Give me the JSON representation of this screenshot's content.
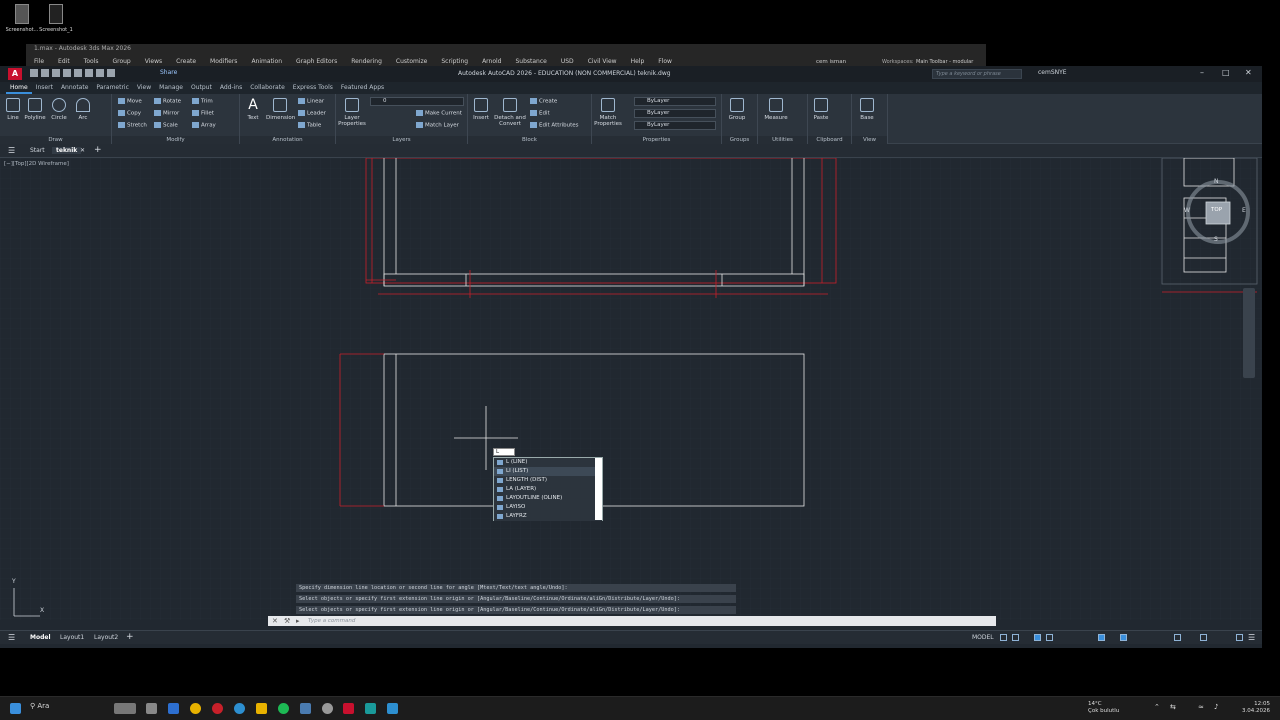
{
  "desktop": {
    "icons": [
      {
        "label": "Screenshot..."
      },
      {
        "label": "Screenshot_1"
      }
    ]
  },
  "max": {
    "title": "1.max - Autodesk 3ds Max 2026",
    "menu": [
      "File",
      "Edit",
      "Tools",
      "Group",
      "Views",
      "Create",
      "Modifiers",
      "Animation",
      "Graph Editors",
      "Rendering",
      "Customize",
      "Scripting",
      "Arnold",
      "Substance",
      "USD",
      "Civil View",
      "Help",
      "Flow"
    ],
    "user": "cem isman",
    "workspace_label": "Workspaces:",
    "workspace": "Main Toolbar - modular"
  },
  "acad": {
    "title": "Autodesk AutoCAD 2026 - EDUCATION (NON COMMERCIAL)   teknik.dwg",
    "share": "Share",
    "search_placeholder": "Type a keyword or phrase",
    "user": "cemSNYE",
    "app_letter": "A",
    "tabs": [
      "Home",
      "Insert",
      "Annotate",
      "Parametric",
      "View",
      "Manage",
      "Output",
      "Add-ins",
      "Collaborate",
      "Express Tools",
      "Featured Apps"
    ],
    "ribbon": {
      "draw": {
        "title": "Draw",
        "line": "Line",
        "polyline": "Polyline",
        "circle": "Circle",
        "arc": "Arc"
      },
      "modify": {
        "title": "Modify",
        "move": "Move",
        "rotate": "Rotate",
        "trim": "Trim",
        "copy": "Copy",
        "mirror": "Mirror",
        "fillet": "Fillet",
        "stretch": "Stretch",
        "scale": "Scale",
        "array": "Array"
      },
      "annotation": {
        "title": "Annotation",
        "text": "Text",
        "dimension": "Dimension",
        "linear": "Linear",
        "leader": "Leader",
        "table": "Table"
      },
      "layers": {
        "title": "Layers",
        "layer_props": "Layer Properties",
        "make_current": "Make Current",
        "match_layer": "Match Layer",
        "layer_value": "0"
      },
      "block": {
        "title": "Block",
        "insert": "Insert",
        "detach": "Detach and Convert",
        "create": "Create",
        "edit": "Edit",
        "edit_attr": "Edit Attributes"
      },
      "properties": {
        "title": "Properties",
        "match": "Match Properties",
        "bylayer1": "ByLayer",
        "bylayer2": "ByLayer",
        "bylayer3": "ByLayer"
      },
      "groups": {
        "title": "Groups",
        "group": "Group"
      },
      "utilities": {
        "title": "Utilities",
        "measure": "Measure"
      },
      "clipboard": {
        "title": "Clipboard",
        "paste": "Paste"
      },
      "view": {
        "title": "View",
        "base": "Base"
      }
    },
    "doctabs": {
      "start": "Start",
      "file": "teknik"
    },
    "view_label": "[−][Top][2D Wireframe]",
    "viewcube": {
      "top": "TOP",
      "n": "N",
      "s": "S",
      "w": "W",
      "e": "E"
    },
    "autocomplete": {
      "input": "L",
      "items": [
        "L (LINE)",
        "LI (LIST)",
        "LENGTH (DIST)",
        "LA (LAYER)",
        "LAYOUTLINE (OLINE)",
        "LAYISO",
        "LAYFRZ"
      ]
    },
    "command_history": [
      "Specify dimension line location or second line for angle [Mtext/Text/text angle/Undo]:",
      "Select objects or specify first extension line origin or [Angular/Baseline/Continue/Ordinate/aliGn/Distribute/Layer/Undo]:",
      "Select objects or specify first extension line origin or [Angular/Baseline/Continue/Ordinate/aliGn/Distribute/Layer/Undo]:"
    ],
    "command_placeholder": "Type a command",
    "layouts": [
      "Model",
      "Layout1",
      "Layout2"
    ],
    "model_label": "MODEL",
    "ucs": {
      "x": "X",
      "y": "Y"
    }
  },
  "taskbar": {
    "search": "Ara",
    "weather_temp": "14°C",
    "weather_text": "Çok bulutlu",
    "time": "12:05",
    "date": "3.04.2026"
  },
  "colors": {
    "accent": "#3a8fdc",
    "red_layer": "#d4202a",
    "bg": "#212830"
  }
}
